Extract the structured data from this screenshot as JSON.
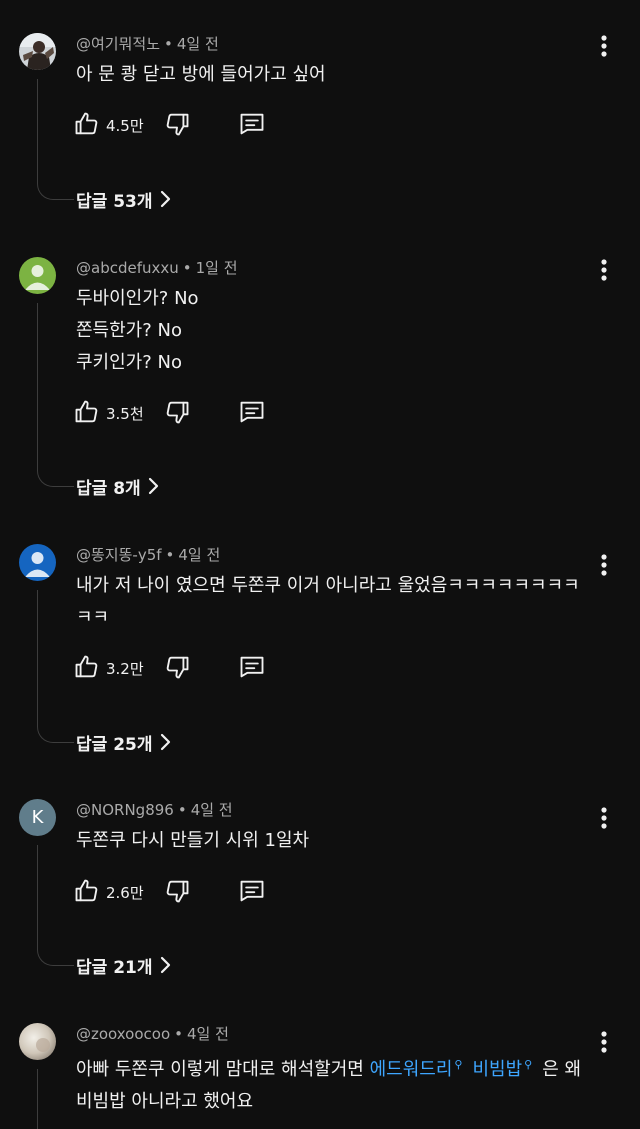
{
  "comments": [
    {
      "handle": "@여기뭐적노",
      "age": "4일 전",
      "lines": [
        "아 문 쾅 닫고 방에 들어가고 싶어"
      ],
      "likes": "4.5만",
      "replies": "답글 53개",
      "avatar": "photo-avatar"
    },
    {
      "handle": "@abcdefuxxu",
      "age": "1일 전",
      "lines": [
        "두바이인가? No",
        "쫀득한가? No",
        "쿠키인가? No"
      ],
      "likes": "3.5천",
      "replies": "답글 8개",
      "avatar": "default-avatar-green"
    },
    {
      "handle": "@똥지똥-y5f",
      "age": "4일 전",
      "lines": [
        "내가 저 나이 였으면 두쫀쿠 이거 아니라고 울었음ㅋㅋㅋㅋㅋㅋㅋㅋ",
        "ㅋㅋ"
      ],
      "likes": "3.2만",
      "replies": "답글 25개",
      "avatar": "default-avatar-blue"
    },
    {
      "handle": "@NORNg896",
      "age": "4일 전",
      "lines": [
        "두쫀쿠 다시 만들기 시위 1일차"
      ],
      "likes": "2.6만",
      "replies": "답글 21개",
      "avatar": "letter-avatar",
      "avatar_letter": "K"
    },
    {
      "handle": "@zooxoocoo",
      "age": "4일 전",
      "line1_text": "아빠 두쫀쿠 이렇게 맘대로 해석할거면 ",
      "link1": "에드워드리",
      "link2": "비빔밥",
      "line1_tail": "은 왜",
      "line2": "비빔밥 아니라고 했어요",
      "avatar": "photo-avatar-light"
    }
  ],
  "icons": {
    "like": "thumbs-up-icon",
    "dislike": "thumbs-down-icon",
    "reply": "reply-comment-icon",
    "more": "more-vert-icon",
    "chevron": "chevron-right-icon",
    "search": "search-magnifier-icon"
  },
  "colors": {
    "background": "#0f0f0f",
    "text": "#f1f1f1",
    "meta": "#aaaaaa",
    "link": "#3ea6ff",
    "avatar_green": "#7cb342",
    "avatar_blue": "#1565c0",
    "avatar_letter_bg": "#607d8b"
  }
}
